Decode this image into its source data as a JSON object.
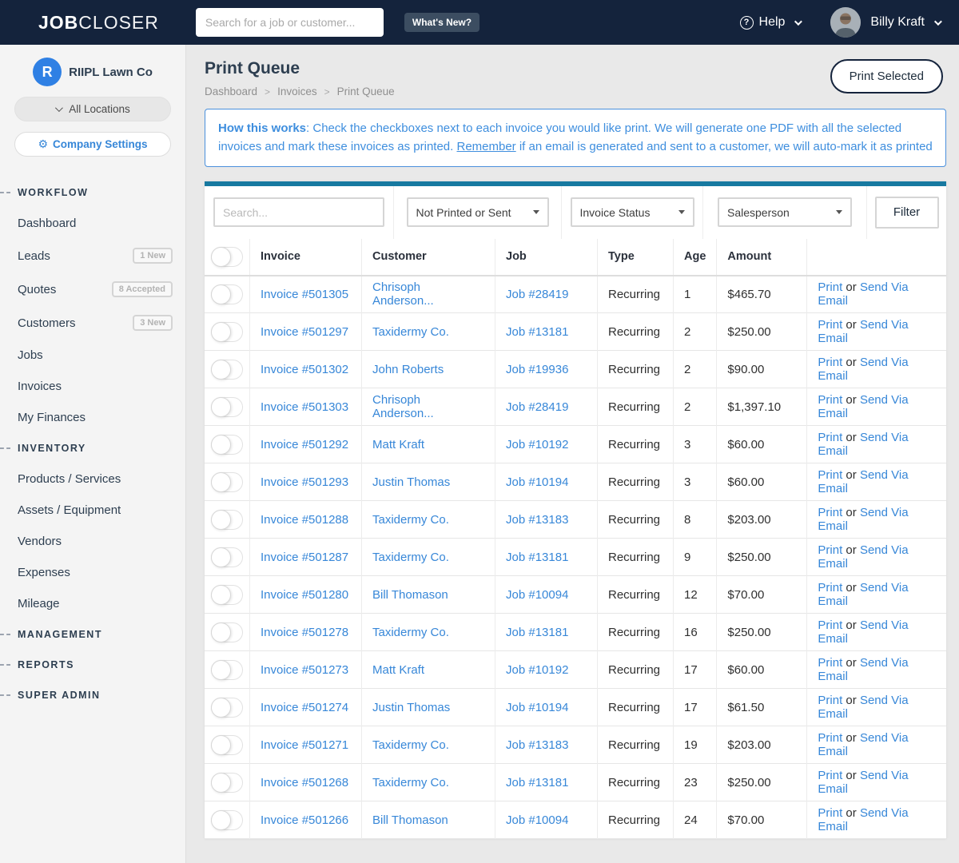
{
  "colors": {
    "navy": "#14233C",
    "navy-text": "#2D3E50",
    "link-blue": "#3787D8",
    "info-blue": "#3E8EDE",
    "teal": "#1779A0",
    "sidebar-bg": "#F4F4F4",
    "main-bg": "#E9E9E9",
    "badge-gray": "#B3B3B3"
  },
  "navbar": {
    "logo_bold": "JOB",
    "logo_light": "CLOSER",
    "search_placeholder": "Search for a job or customer...",
    "whats_new_label": "What's New?",
    "help_icon": "?",
    "help_label": "Help",
    "user_name": "Billy Kraft"
  },
  "sidebar": {
    "company": {
      "initial": "R",
      "name": "RIIPL Lawn Co"
    },
    "locations_label": "All Locations",
    "settings_label": "Company Settings",
    "gear_icon": "⚙",
    "sections": [
      {
        "header": "WORKFLOW",
        "items": [
          {
            "label": "Dashboard",
            "badge": ""
          },
          {
            "label": "Leads",
            "badge": "1 New"
          },
          {
            "label": "Quotes",
            "badge": "8 Accepted"
          },
          {
            "label": "Customers",
            "badge": "3 New"
          },
          {
            "label": "Jobs",
            "badge": ""
          },
          {
            "label": "Invoices",
            "badge": ""
          },
          {
            "label": "My Finances",
            "badge": ""
          }
        ]
      },
      {
        "header": "INVENTORY",
        "items": [
          {
            "label": "Products / Services",
            "badge": ""
          },
          {
            "label": "Assets / Equipment",
            "badge": ""
          },
          {
            "label": "Vendors",
            "badge": ""
          },
          {
            "label": "Expenses",
            "badge": ""
          },
          {
            "label": "Mileage",
            "badge": ""
          }
        ]
      },
      {
        "header": "MANAGEMENT",
        "items": []
      },
      {
        "header": "REPORTS",
        "items": []
      },
      {
        "header": "SUPER ADMIN",
        "items": []
      }
    ]
  },
  "main": {
    "title": "Print Queue",
    "breadcrumb": [
      "Dashboard",
      "Invoices",
      "Print Queue"
    ],
    "print_selected_label": "Print Selected",
    "info": {
      "bold": "How this works",
      "text1": ": Check the checkboxes next to each invoice you would like print. We will generate one PDF with all the selected invoices and mark these invoices as printed. ",
      "underline": "Remember",
      "text2": " if an email is generated and sent to a customer, we will auto-mark it as printed"
    },
    "filters": {
      "search_placeholder": "Search...",
      "selects": [
        "Not Printed or Sent",
        "Invoice Status",
        "Salesperson"
      ],
      "button_label": "Filter"
    },
    "table": {
      "columns": [
        "Invoice",
        "Customer",
        "Job",
        "Type",
        "Age",
        "Amount"
      ],
      "actions": {
        "print": "Print",
        "or": " or ",
        "email": "Send Via Email"
      },
      "rows": [
        {
          "invoice": "Invoice #501305",
          "customer": "Chrisoph Anderson...",
          "job": "Job #28419",
          "type": "Recurring",
          "age": "1",
          "amount": "$465.70"
        },
        {
          "invoice": "Invoice #501297",
          "customer": "Taxidermy Co.",
          "job": "Job #13181",
          "type": "Recurring",
          "age": "2",
          "amount": "$250.00"
        },
        {
          "invoice": "Invoice #501302",
          "customer": "John Roberts",
          "job": "Job #19936",
          "type": "Recurring",
          "age": "2",
          "amount": "$90.00"
        },
        {
          "invoice": "Invoice #501303",
          "customer": "Chrisoph Anderson...",
          "job": "Job #28419",
          "type": "Recurring",
          "age": "2",
          "amount": "$1,397.10"
        },
        {
          "invoice": "Invoice #501292",
          "customer": "Matt Kraft",
          "job": "Job #10192",
          "type": "Recurring",
          "age": "3",
          "amount": "$60.00"
        },
        {
          "invoice": "Invoice #501293",
          "customer": "Justin Thomas",
          "job": "Job #10194",
          "type": "Recurring",
          "age": "3",
          "amount": "$60.00"
        },
        {
          "invoice": "Invoice #501288",
          "customer": "Taxidermy Co.",
          "job": "Job #13183",
          "type": "Recurring",
          "age": "8",
          "amount": "$203.00"
        },
        {
          "invoice": "Invoice #501287",
          "customer": "Taxidermy Co.",
          "job": "Job #13181",
          "type": "Recurring",
          "age": "9",
          "amount": "$250.00"
        },
        {
          "invoice": "Invoice #501280",
          "customer": "Bill Thomason",
          "job": "Job #10094",
          "type": "Recurring",
          "age": "12",
          "amount": "$70.00"
        },
        {
          "invoice": "Invoice #501278",
          "customer": "Taxidermy Co.",
          "job": "Job #13181",
          "type": "Recurring",
          "age": "16",
          "amount": "$250.00"
        },
        {
          "invoice": "Invoice #501273",
          "customer": "Matt Kraft",
          "job": "Job #10192",
          "type": "Recurring",
          "age": "17",
          "amount": "$60.00"
        },
        {
          "invoice": "Invoice #501274",
          "customer": "Justin Thomas",
          "job": "Job #10194",
          "type": "Recurring",
          "age": "17",
          "amount": "$61.50"
        },
        {
          "invoice": "Invoice #501271",
          "customer": "Taxidermy Co.",
          "job": "Job #13183",
          "type": "Recurring",
          "age": "19",
          "amount": "$203.00"
        },
        {
          "invoice": "Invoice #501268",
          "customer": "Taxidermy Co.",
          "job": "Job #13181",
          "type": "Recurring",
          "age": "23",
          "amount": "$250.00"
        },
        {
          "invoice": "Invoice #501266",
          "customer": "Bill Thomason",
          "job": "Job #10094",
          "type": "Recurring",
          "age": "24",
          "amount": "$70.00"
        }
      ]
    }
  }
}
